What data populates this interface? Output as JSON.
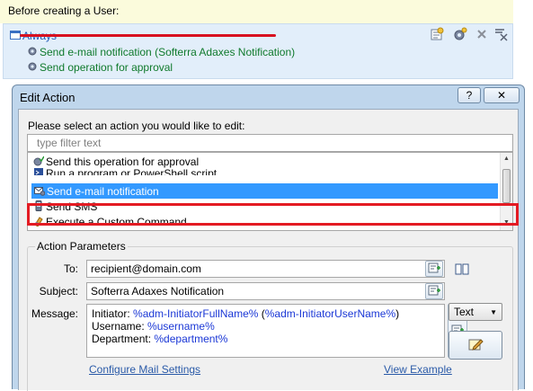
{
  "trigger": {
    "label": "Before creating a User:"
  },
  "rule": {
    "condition_label": "Always",
    "actions": [
      "Send e-mail notification (Softerra Adaxes Notification)",
      "Send operation for approval"
    ]
  },
  "toolbar": {
    "icons": [
      "add-condition-icon",
      "add-action-icon",
      "delete-icon",
      "clear-icon"
    ]
  },
  "dialog": {
    "title": "Edit Action",
    "help_label": "?",
    "close_label": "✕",
    "select_label": "Please select an action you would like to edit:",
    "filter_placeholder": "type filter text",
    "actions": [
      {
        "label": "Send this operation for approval",
        "icon": "approval-icon"
      },
      {
        "label": "Run a program or PowerShell script",
        "icon": "script-icon"
      },
      {
        "label": "Send e-mail notification",
        "icon": "email-gear-icon",
        "selected": true
      },
      {
        "label": "Send SMS",
        "icon": "sms-icon"
      },
      {
        "label": "Execute a Custom Command",
        "icon": "command-icon"
      }
    ],
    "params": {
      "legend": "Action Parameters",
      "to_label": "To:",
      "to_value": "recipient@domain.com",
      "subject_label": "Subject:",
      "subject_value": "Softerra Adaxes Notification",
      "message_label": "Message:",
      "message": {
        "line1_prefix": "Initiator: ",
        "line1_var1": "%adm-InitiatorFullName%",
        "line1_mid": " (",
        "line1_var2": "%adm-InitiatorUserName%",
        "line1_suffix": ")",
        "line2_prefix": "Username: ",
        "line2_var": "%username%",
        "line3_prefix": "Department: ",
        "line3_var": "%department%"
      },
      "format_value": "Text",
      "configure_link": "Configure Mail Settings",
      "view_example_link": "View Example"
    }
  },
  "colors": {
    "highlight_red": "#e31b23",
    "selection_blue": "#3399ff",
    "rule_green": "#107a2c",
    "variable_blue": "#1a37d6"
  }
}
